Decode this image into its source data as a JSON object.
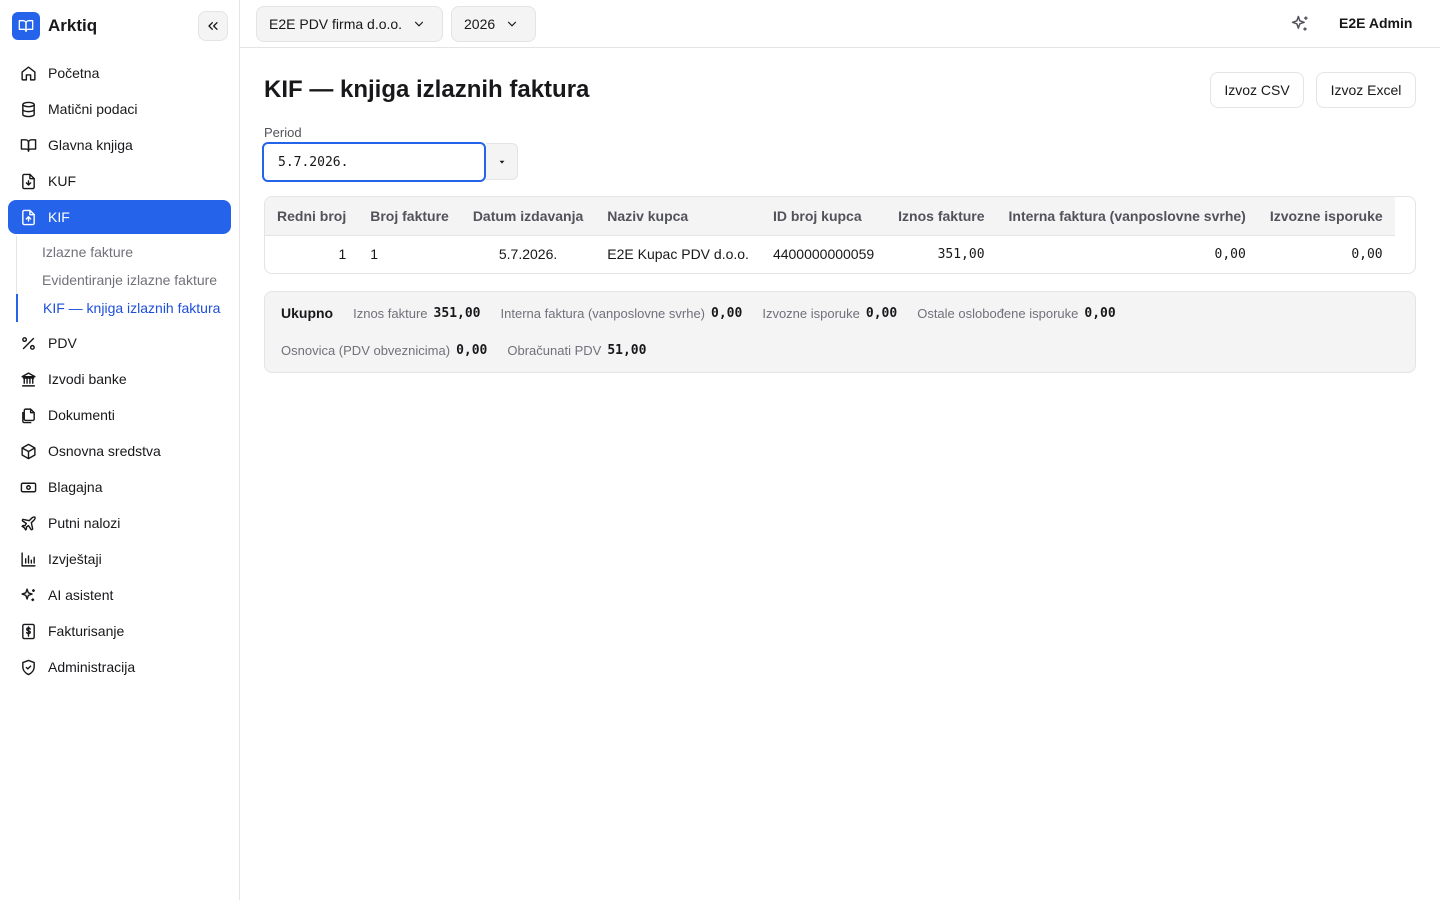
{
  "app": {
    "name": "Arktiq"
  },
  "colors": {
    "accent": "#2563eb",
    "accent_dark": "#1d4ed8",
    "muted_bg": "#f4f4f5",
    "border": "#e4e4e7"
  },
  "topbar": {
    "company": "E2E PDV firma d.o.o.",
    "year": "2026",
    "user": "E2E Admin"
  },
  "sidebar": {
    "items": [
      {
        "label": "Početna",
        "icon": "home-icon"
      },
      {
        "label": "Matični podaci",
        "icon": "database-icon"
      },
      {
        "label": "Glavna knjiga",
        "icon": "book-open-icon"
      },
      {
        "label": "KUF",
        "icon": "file-download-icon"
      },
      {
        "label": "KIF",
        "icon": "file-upload-icon"
      },
      {
        "label": "PDV",
        "icon": "percent-icon"
      },
      {
        "label": "Izvodi banke",
        "icon": "bank-icon"
      },
      {
        "label": "Dokumenti",
        "icon": "files-icon"
      },
      {
        "label": "Osnovna sredstva",
        "icon": "box-icon"
      },
      {
        "label": "Blagajna",
        "icon": "cash-icon"
      },
      {
        "label": "Putni nalozi",
        "icon": "plane-icon"
      },
      {
        "label": "Izvještaji",
        "icon": "bar-chart-icon"
      },
      {
        "label": "AI asistent",
        "icon": "sparkle-icon"
      },
      {
        "label": "Fakturisanje",
        "icon": "invoice-dollar-icon"
      },
      {
        "label": "Administracija",
        "icon": "shield-icon"
      }
    ],
    "kif_sub": [
      {
        "label": "Izlazne fakture"
      },
      {
        "label": "Evidentiranje izlazne fakture"
      },
      {
        "label": "KIF — knjiga izlaznih faktura"
      }
    ]
  },
  "main": {
    "title": "KIF — knjiga izlaznih faktura",
    "export_csv": "Izvoz CSV",
    "export_excel": "Izvoz Excel",
    "period_label": "Period",
    "period_value": "5.7.2026."
  },
  "table": {
    "columns": [
      "Redni broj",
      "Broj fakture",
      "Datum izdavanja",
      "Naziv kupca",
      "ID broj kupca",
      "Iznos fakture",
      "Interna faktura (vanposlovne svrhe)",
      "Izvozne isporuke"
    ],
    "rows": [
      {
        "redni_broj": "1",
        "broj_fakture": "1",
        "datum": "5.7.2026.",
        "kupac": "E2E Kupac PDV d.o.o.",
        "id_broj": "4400000000059",
        "iznos": "351,00",
        "interna": "0,00",
        "izvozne": "0,00"
      }
    ]
  },
  "totals": {
    "title": "Ukupno",
    "items": [
      {
        "label": "Iznos fakture",
        "value": "351,00"
      },
      {
        "label": "Interna faktura (vanposlovne svrhe)",
        "value": "0,00"
      },
      {
        "label": "Izvozne isporuke",
        "value": "0,00"
      },
      {
        "label": "Ostale oslobođene isporuke",
        "value": "0,00"
      },
      {
        "label": "Osnovica (PDV obveznicima)",
        "value": "0,00"
      },
      {
        "label": "Obračunati PDV",
        "value": "51,00"
      }
    ]
  }
}
